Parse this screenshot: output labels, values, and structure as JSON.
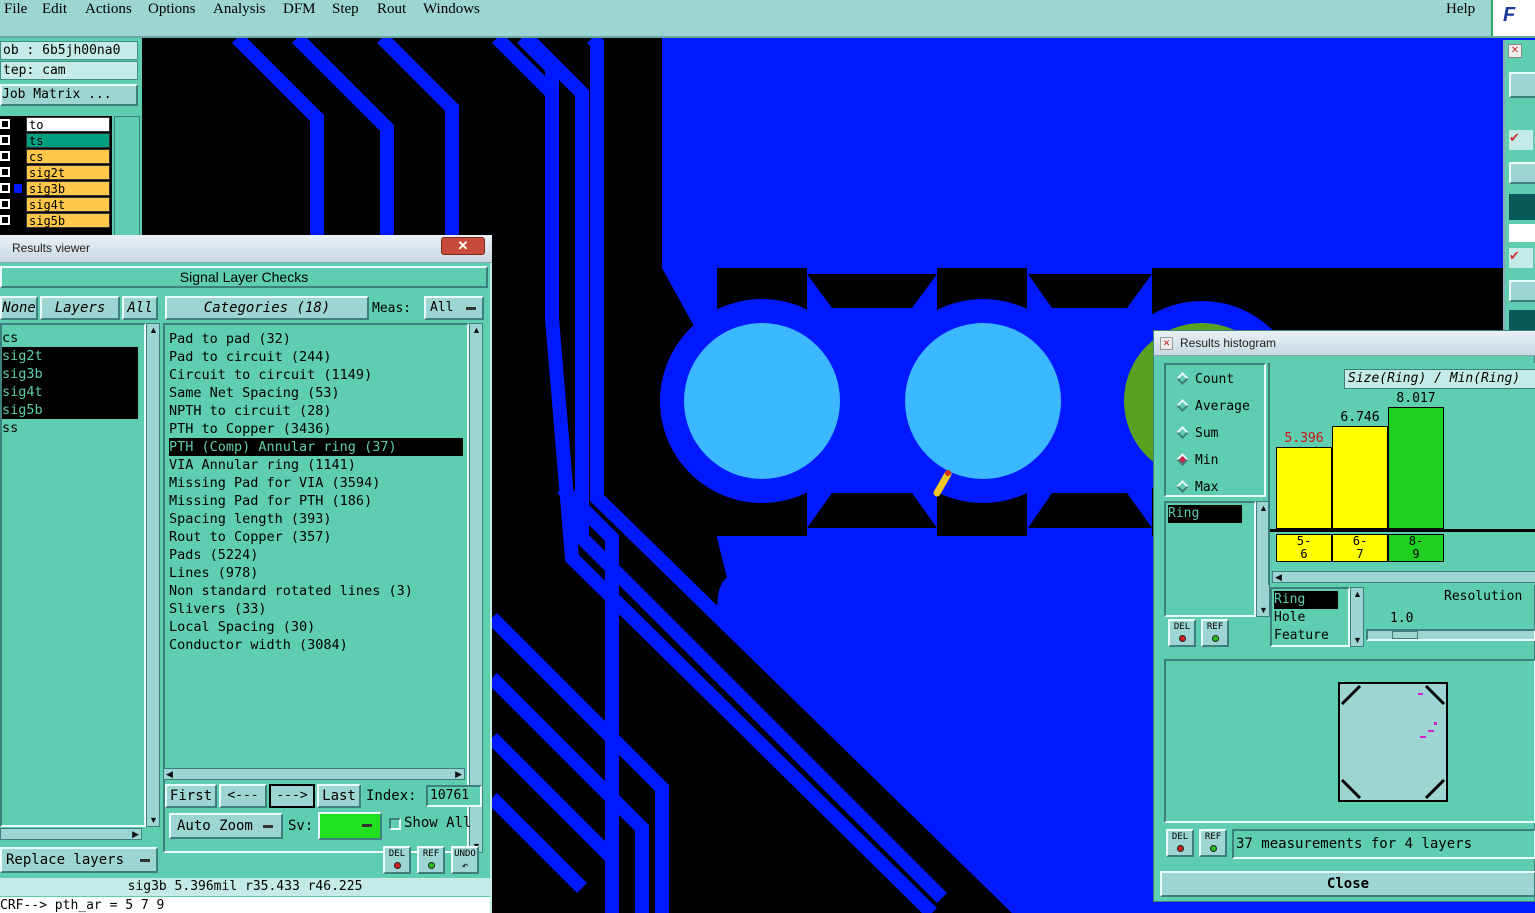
{
  "menu": {
    "items": [
      "File",
      "Edit",
      "Actions",
      "Options",
      "Analysis",
      "DFM",
      "Step",
      "Rout",
      "Windows"
    ],
    "help": "Help"
  },
  "left_panel": {
    "job": "ob : 6b5jh00na0",
    "step": "tep: cam",
    "job_matrix_button": "Job Matrix ...",
    "layers": [
      {
        "name": "to",
        "color": "#ffffff"
      },
      {
        "name": "ts",
        "color": "#00a080"
      },
      {
        "name": "cs",
        "color": "#ffc84a"
      },
      {
        "name": "sig2t",
        "color": "#ffc84a"
      },
      {
        "name": "sig3b",
        "color": "#ffc84a"
      },
      {
        "name": "sig4t",
        "color": "#ffc84a"
      },
      {
        "name": "sig5b",
        "color": "#ffc84a"
      }
    ]
  },
  "results_viewer": {
    "title": "Results viewer",
    "close": "✕",
    "header": "Signal Layer Checks",
    "none_button": "None",
    "layers_button": "Layers",
    "all_button": "All",
    "categories_button": "Categories (18)",
    "meas_label": "Meas:",
    "meas_value": "All",
    "layer_list": [
      {
        "name": "cs",
        "selected": false
      },
      {
        "name": "sig2t",
        "selected": true
      },
      {
        "name": "sig3b",
        "selected": true
      },
      {
        "name": "sig4t",
        "selected": true
      },
      {
        "name": "sig5b",
        "selected": true
      },
      {
        "name": "ss",
        "selected": false
      }
    ],
    "categories": [
      {
        "label": "Pad to pad (32)",
        "selected": false
      },
      {
        "label": "Pad to circuit (244)",
        "selected": false
      },
      {
        "label": "Circuit to circuit (1149)",
        "selected": false
      },
      {
        "label": "Same Net Spacing (53)",
        "selected": false
      },
      {
        "label": "NPTH to circuit (28)",
        "selected": false
      },
      {
        "label": "PTH to Copper (3436)",
        "selected": false
      },
      {
        "label": "PTH (Comp) Annular ring (37)",
        "selected": true
      },
      {
        "label": "VIA Annular ring (1141)",
        "selected": false
      },
      {
        "label": "Missing Pad for VIA (3594)",
        "selected": false
      },
      {
        "label": "Missing Pad for PTH (186)",
        "selected": false
      },
      {
        "label": "Spacing length (393)",
        "selected": false
      },
      {
        "label": "Rout to Copper (357)",
        "selected": false
      },
      {
        "label": "Pads (5224)",
        "selected": false
      },
      {
        "label": "Lines (978)",
        "selected": false
      },
      {
        "label": "Non standard rotated lines (3)",
        "selected": false
      },
      {
        "label": "Slivers (33)",
        "selected": false
      },
      {
        "label": "Local Spacing (30)",
        "selected": false
      },
      {
        "label": "Conductor width (3084)",
        "selected": false
      }
    ],
    "nav": {
      "first": "First",
      "prev": "<---",
      "next": "--->",
      "last": "Last",
      "index_label": "Index:",
      "index_value": "10761"
    },
    "zoom": "Auto Zoom",
    "sv_label": "Sv:",
    "show_all": "Show All",
    "replace_layers": "Replace layers",
    "del": "DEL",
    "ref": "REF",
    "undo": "UNDO",
    "status_line": "sig3b 5.396mil  r35.433  r46.225",
    "command_line": "CRF--> pth_ar = 5 7 9"
  },
  "histogram": {
    "title": "Results histogram",
    "options": [
      {
        "label": "Count",
        "selected": false
      },
      {
        "label": "Average",
        "selected": false
      },
      {
        "label": "Sum",
        "selected": false
      },
      {
        "label": "Min",
        "selected": true
      },
      {
        "label": "Max",
        "selected": false
      }
    ],
    "chart_title": "Size(Ring) / Min(Ring)",
    "bars": [
      {
        "value": "5.396",
        "bin": "5-\n6",
        "color": "#ffff00",
        "value_color": "#d01010",
        "h": 5.396
      },
      {
        "value": "6.746",
        "bin": "6-\n7",
        "color": "#ffff00",
        "value_color": "#000000",
        "h": 6.746
      },
      {
        "value": "8.017",
        "bin": "8-\n9",
        "color": "#20d020",
        "value_color": "#000000",
        "h": 8.017
      }
    ],
    "measure_list": [
      "Ring"
    ],
    "type_list": [
      "Ring",
      "Hole",
      "Feature"
    ],
    "resolution_label": "Resolution",
    "resolution_value": "1.0",
    "del": "DEL",
    "ref": "REF",
    "summary": "37 measurements for 4 layers",
    "close": "Close"
  },
  "colors": {
    "panel": "#5fcdb0",
    "panel_light": "#9dd5d3",
    "copper": "#0019ff",
    "pad": "#3bb8ff",
    "background": "#000000"
  }
}
